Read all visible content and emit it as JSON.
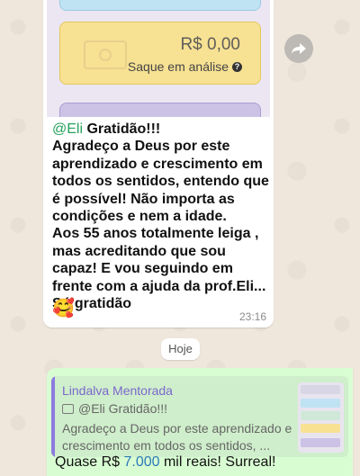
{
  "incoming_message": {
    "image_preview": {
      "value": "R$ 0,00",
      "status": "Saque em análise",
      "status_icon": "help-icon"
    },
    "mention": "@Eli",
    "lines": [
      "Gratidão!!!",
      "Agradeço a Deus por este aprendizado e crescimento em todos os sentidos, entendo que é possível! Não importa as condições e nem a idade.",
      "Aos 55 anos totalmente leiga , mas acreditando que sou capaz! E vou  seguindo em frente com a ajuda da prof.Eli... Só gratidão"
    ],
    "emoji": "🥰",
    "time": "23:16"
  },
  "forward_icon": "forward-icon",
  "day_divider": "Hoje",
  "outgoing_message": {
    "quote": {
      "author": "Lindalva Mentorada",
      "line1": "@Eli Gratidão!!!",
      "line2": "Agradeço a Deus por este aprendizado e crescimento em todos os sentidos, ..."
    },
    "text_prefix": "Quase R$ ",
    "text_amount": "7.000",
    "text_suffix": " mil reais! Surreal!"
  },
  "colors": {
    "chat_background": "#efe7dc",
    "incoming_bubble": "#ffffff",
    "outgoing_bubble": "#d9fdd3",
    "mention": "#25a05a",
    "quote_author": "#7b68cc"
  }
}
